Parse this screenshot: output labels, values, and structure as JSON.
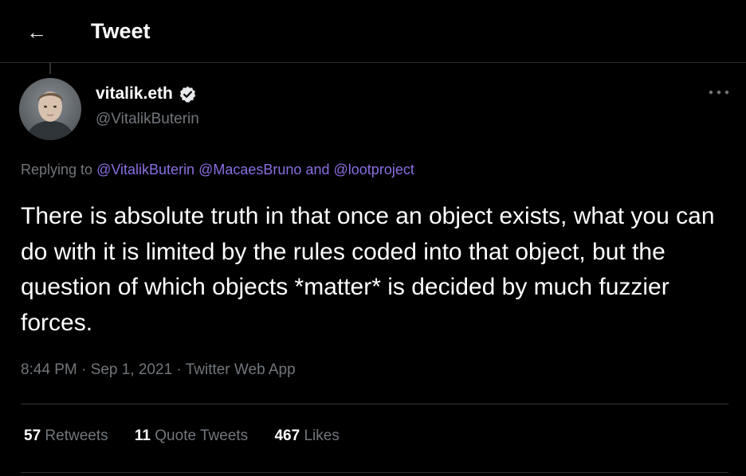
{
  "header": {
    "back_icon": "arrow-left-icon",
    "title": "Tweet"
  },
  "tweet": {
    "author": {
      "name": "vitalik.eth",
      "handle": "@VitalikButerin",
      "verified_icon": "verified-badge-icon",
      "avatar": "avatar-photo"
    },
    "more_icon": "more-horizontal-icon",
    "replying": {
      "prefix": "Replying to",
      "mention1": "@VitalikButerin",
      "mention2": "@MacaesBruno",
      "and": "and",
      "mention3": "@lootproject"
    },
    "text": "There is absolute truth in that once an object exists, what you can do with it is limited by the rules coded into that object, but the question of which objects *matter* is decided by much fuzzier forces.",
    "time": "8:44 PM",
    "date": "Sep 1, 2021",
    "source": "Twitter Web App",
    "separator": "·"
  },
  "stats": {
    "retweets_count": "57",
    "retweets_label": "Retweets",
    "quotes_count": "11",
    "quotes_label": "Quote Tweets",
    "likes_count": "467",
    "likes_label": "Likes"
  },
  "colors": {
    "background": "#000000",
    "text": "#ffffff",
    "secondary": "#71767b",
    "mention": "#8b6fe0",
    "divider": "#2f3336"
  }
}
